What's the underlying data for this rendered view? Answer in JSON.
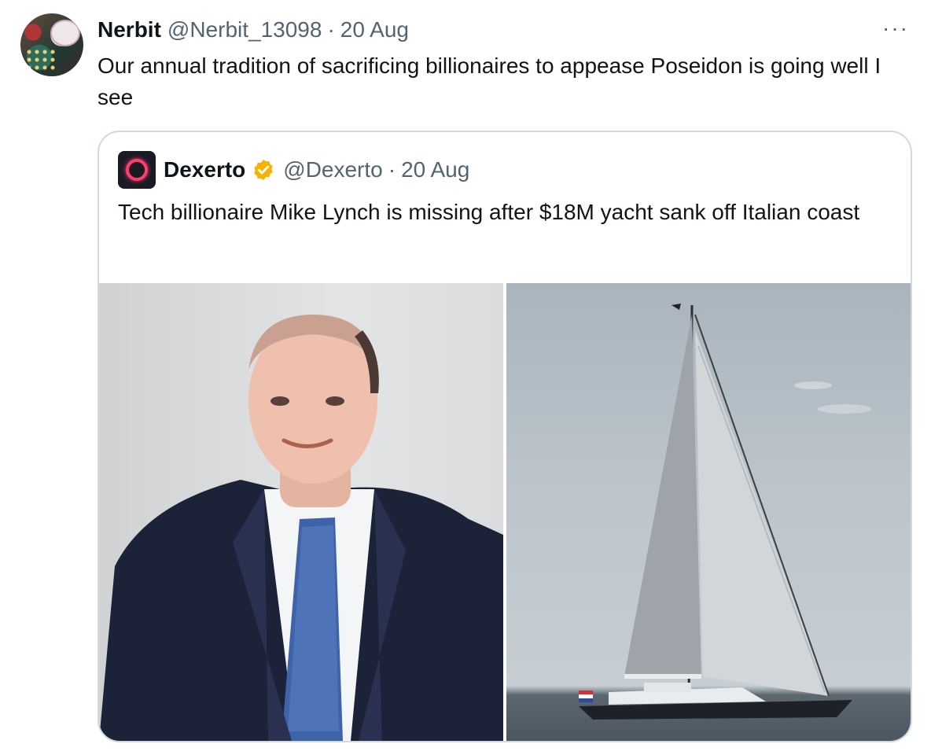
{
  "tweet": {
    "author_name": "Nerbit",
    "handle": "@Nerbit_13098",
    "separator": "·",
    "date": "20 Aug",
    "more": "···",
    "text": "Our annual tradition of sacrificing billionaires to appease Poseidon is going well I see"
  },
  "quoted_tweet": {
    "author_name": "Dexerto",
    "handle": "@Dexerto",
    "separator": "·",
    "date": "20 Aug",
    "text": "Tech billionaire Mike Lynch is missing after $18M yacht sank off Italian coast",
    "verified_badge_color": "#f4b400"
  },
  "colors": {
    "text": "#0f1419",
    "muted": "#536471",
    "border": "#cfd9de"
  },
  "icons": {
    "more": "more-horizontal-icon",
    "verified": "verified-badge-icon"
  }
}
